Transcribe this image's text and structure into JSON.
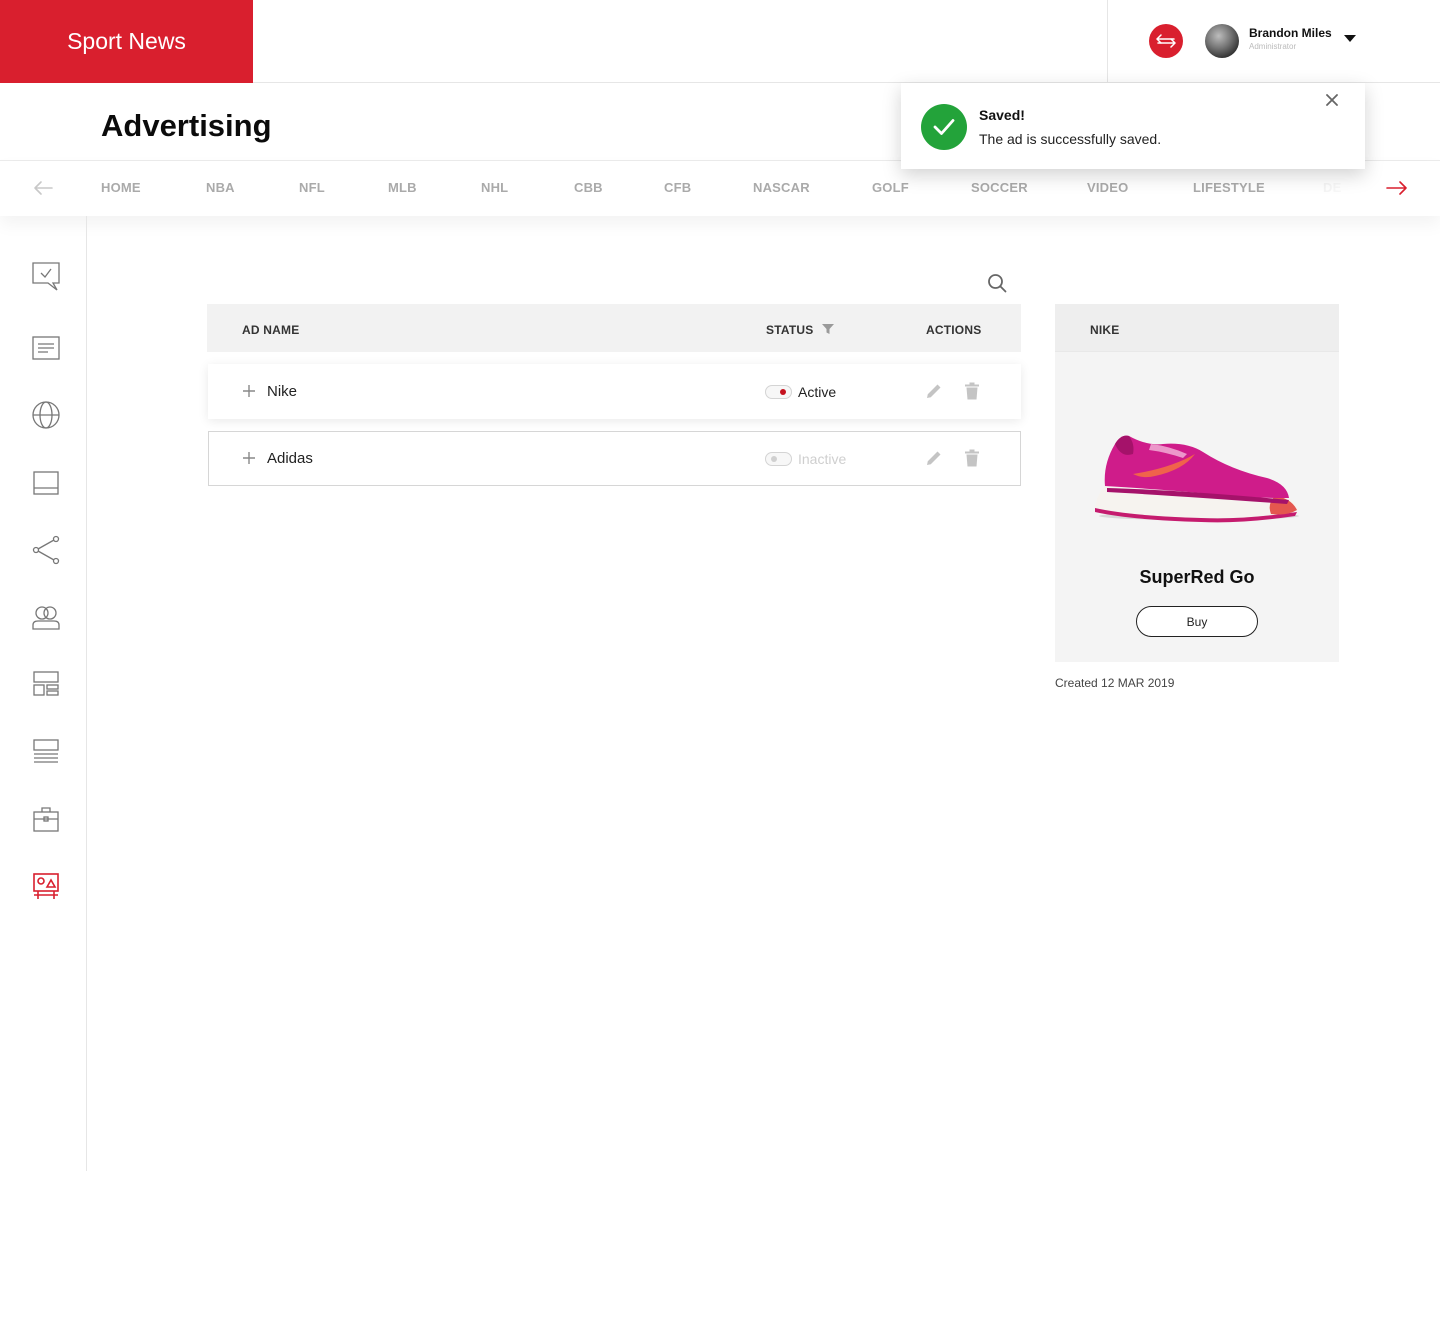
{
  "brand": {
    "name": "Sport News",
    "color": "#d91f2e"
  },
  "header": {
    "swap_icon": "swap-arrows-icon",
    "user": {
      "name": "Brandon Miles",
      "role": "Administrator"
    }
  },
  "page": {
    "title": "Advertising"
  },
  "categories": [
    "HOME",
    "NBA",
    "NFL",
    "MLB",
    "NHL",
    "CBB",
    "CFB",
    "NASCAR",
    "GOLF",
    "SOCCER",
    "VIDEO",
    "LIFESTYLE",
    "DE"
  ],
  "sidebar": {
    "items": [
      {
        "icon": "chat-check-icon",
        "active": false
      },
      {
        "icon": "article-icon",
        "active": false
      },
      {
        "icon": "globe-icon",
        "active": false
      },
      {
        "icon": "layout-icon",
        "active": false
      },
      {
        "icon": "share-icon",
        "active": false
      },
      {
        "icon": "users-icon",
        "active": false
      },
      {
        "icon": "grid-layout-icon",
        "active": false
      },
      {
        "icon": "list-layout-icon",
        "active": false
      },
      {
        "icon": "briefcase-icon",
        "active": false
      },
      {
        "icon": "billboard-icon",
        "active": true
      }
    ]
  },
  "table": {
    "columns": {
      "name": "AD NAME",
      "status": "STATUS",
      "actions": "ACTIONS"
    },
    "rows": [
      {
        "name": "Nike",
        "status": "Active",
        "active": true
      },
      {
        "name": "Adidas",
        "status": "Inactive",
        "active": false
      }
    ]
  },
  "preview": {
    "title": "NIKE",
    "product": "SuperRed Go",
    "button": "Buy",
    "created": "Created 12 MAR 2019"
  },
  "toast": {
    "title": "Saved!",
    "message": "The ad is successfully saved.",
    "color": "#23a33a"
  }
}
